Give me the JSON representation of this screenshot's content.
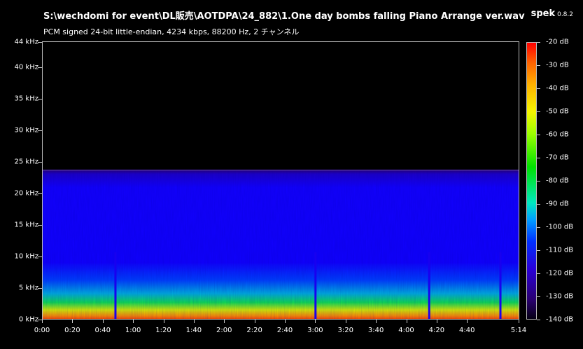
{
  "file_title": "S:\\wechdomi for event\\DL販売\\AOTDPA\\24_882\\1.One day bombs falling Piano Arrange ver.wav",
  "app": {
    "name": "spek",
    "version": "0.8.2"
  },
  "stream_info": "PCM signed 24-bit little-endian, 4234 kbps, 88200 Hz, 2 チャンネル",
  "y_axis": {
    "unit": "kHz",
    "labels": [
      "44 kHz",
      "40 kHz",
      "35 kHz",
      "30 kHz",
      "25 kHz",
      "20 kHz",
      "15 kHz",
      "10 kHz",
      "5 kHz",
      "0 kHz"
    ]
  },
  "x_axis": {
    "labels": [
      "0:00",
      "0:20",
      "0:40",
      "1:00",
      "1:20",
      "1:40",
      "2:00",
      "2:20",
      "2:40",
      "3:00",
      "3:20",
      "3:40",
      "4:00",
      "4:20",
      "4:40",
      "5:14"
    ]
  },
  "colorbar": {
    "labels": [
      "-20 dB",
      "-30 dB",
      "-40 dB",
      "-50 dB",
      "-60 dB",
      "-70 dB",
      "-80 dB",
      "-90 dB",
      "-100 dB",
      "-110 dB",
      "-120 dB",
      "-130 dB",
      "-140 dB"
    ]
  },
  "chart_data": {
    "type": "heatmap",
    "duration_seconds": 314,
    "frequency_max_khz": 44,
    "bandwidth_cutoff_khz": 23.5,
    "db_range": [
      -140,
      -20
    ],
    "quiet_moments_seconds": [
      48,
      180,
      255,
      302
    ]
  }
}
